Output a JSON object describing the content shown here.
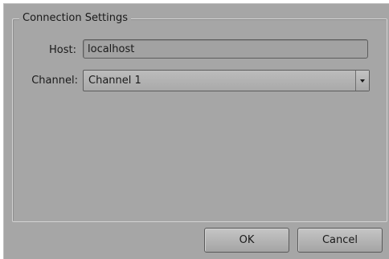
{
  "dialog": {
    "group_title": "Connection Settings",
    "host": {
      "label": "Host:",
      "value": "localhost"
    },
    "channel": {
      "label": "Channel:",
      "selected": "Channel 1"
    },
    "buttons": {
      "ok": "OK",
      "cancel": "Cancel"
    },
    "icons": {
      "dropdown": "chevron-down-icon"
    }
  }
}
